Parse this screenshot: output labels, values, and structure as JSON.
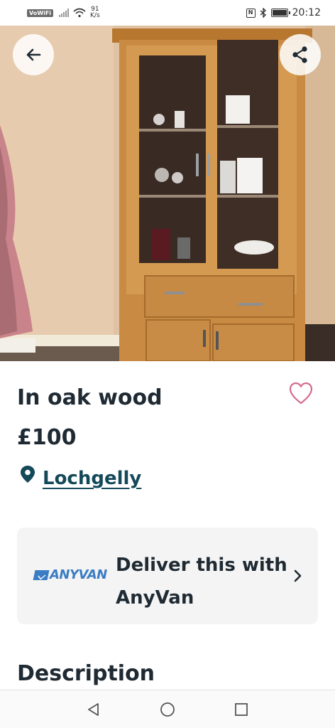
{
  "status_bar": {
    "network_badge": "VoWiFi",
    "speed_value": "91",
    "speed_unit": "K/s",
    "nfc_label": "N",
    "time": "20:12"
  },
  "listing": {
    "title": "In oak wood",
    "price": "£100",
    "location": "Lochgelly"
  },
  "delivery": {
    "brand": "ANYVAN",
    "text": "Deliver this with AnyVan"
  },
  "description": {
    "heading": "Description"
  },
  "icons": {
    "back": "arrow-left-icon",
    "share": "share-icon",
    "favorite": "heart-outline-icon",
    "location": "map-pin-icon",
    "chevron": "chevron-right-icon"
  },
  "colors": {
    "text": "#1f2a33",
    "location_link": "#14495a",
    "favorite": "#d56b8e",
    "brand": "#3b7dc4"
  }
}
